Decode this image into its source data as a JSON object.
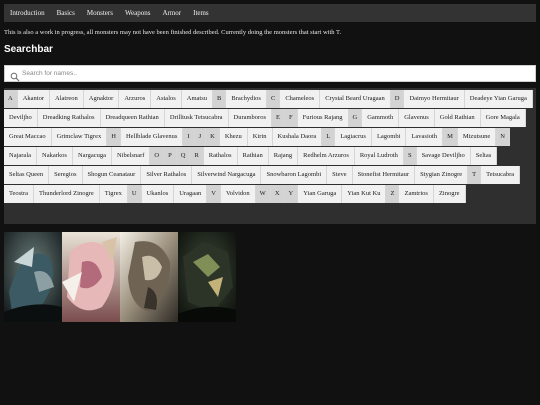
{
  "nav": [
    {
      "label": "Introduction"
    },
    {
      "label": "Basics"
    },
    {
      "label": "Monsters"
    },
    {
      "label": "Weapons"
    },
    {
      "label": "Armor"
    },
    {
      "label": "Items"
    }
  ],
  "notice": "This is also a work in progress, all monsters may not have been finished described. Currently doing the monsters that start with T.",
  "search": {
    "heading": "Searchbar",
    "placeholder": "Search for names.."
  },
  "tags": [
    {
      "t": "A",
      "k": "letter"
    },
    {
      "t": "Akantor"
    },
    {
      "t": "Alatreon"
    },
    {
      "t": "Agnaktor"
    },
    {
      "t": "Arzuros"
    },
    {
      "t": "Astalos"
    },
    {
      "t": "Amatsu"
    },
    {
      "t": "B",
      "k": "letter"
    },
    {
      "t": "Brachydios"
    },
    {
      "t": "C",
      "k": "letter"
    },
    {
      "t": "Chameleos"
    },
    {
      "t": "Crystal Beard Uragaan"
    },
    {
      "t": "D",
      "k": "letter"
    },
    {
      "t": "Daimyo Hermitaur"
    },
    {
      "t": "Deadeye Yian Garuga"
    },
    {
      "t": "Deviljho"
    },
    {
      "t": "Dreadking Rathalos"
    },
    {
      "t": "Dreadqueen Rathian"
    },
    {
      "t": "Drilltusk Tetsucabra"
    },
    {
      "t": "Duramboros"
    },
    {
      "t": "E",
      "k": "letter"
    },
    {
      "t": "F",
      "k": "letter"
    },
    {
      "t": "Furious Rajang"
    },
    {
      "t": "G",
      "k": "letter"
    },
    {
      "t": "Gammoth"
    },
    {
      "t": "Glavenus"
    },
    {
      "t": "Gold Rathian"
    },
    {
      "t": "Gore Magala"
    },
    {
      "t": "Great Maccao"
    },
    {
      "t": "Grimclaw Tigrex"
    },
    {
      "t": "H",
      "k": "letter"
    },
    {
      "t": "Hellblade Glavenus"
    },
    {
      "t": "I",
      "k": "letter"
    },
    {
      "t": "J",
      "k": "letter"
    },
    {
      "t": "K",
      "k": "letter"
    },
    {
      "t": "Khezu"
    },
    {
      "t": "Kirin"
    },
    {
      "t": "Kushala Daora"
    },
    {
      "t": "L",
      "k": "letter"
    },
    {
      "t": "Lagiacrus"
    },
    {
      "t": "Lagombi"
    },
    {
      "t": "Lavasioth"
    },
    {
      "t": "M",
      "k": "letter"
    },
    {
      "t": "Mizutsune"
    },
    {
      "t": "N",
      "k": "letter"
    },
    {
      "t": "Najarala"
    },
    {
      "t": "Nakarkos"
    },
    {
      "t": "Nargacuga"
    },
    {
      "t": "Nibelsnarf"
    },
    {
      "t": "O",
      "k": "letter"
    },
    {
      "t": "P",
      "k": "letter"
    },
    {
      "t": "Q",
      "k": "letter"
    },
    {
      "t": "R",
      "k": "letter"
    },
    {
      "t": "Rathalos"
    },
    {
      "t": "Rathian"
    },
    {
      "t": "Rajang"
    },
    {
      "t": "Redhelm Arzuros"
    },
    {
      "t": "Royal Ludroth"
    },
    {
      "t": "S",
      "k": "letter"
    },
    {
      "t": "Savage Deviljho"
    },
    {
      "t": "Seltas"
    },
    {
      "t": "Seltas Queen"
    },
    {
      "t": "Seregios"
    },
    {
      "t": "Shogun Ceanataur"
    },
    {
      "t": "Silver Rathalos"
    },
    {
      "t": "Silverwind Nargacuga"
    },
    {
      "t": "Snowbaron Lagombi"
    },
    {
      "t": "Steve"
    },
    {
      "t": "Stonefist Hermitaur"
    },
    {
      "t": "Stygian Zinogre"
    },
    {
      "t": "T",
      "k": "letter"
    },
    {
      "t": "Tetsucabra"
    },
    {
      "t": "Teostra"
    },
    {
      "t": "Thunderlord Zinogre"
    },
    {
      "t": "Tigrex"
    },
    {
      "t": "U",
      "k": "letter"
    },
    {
      "t": "Ukanlos"
    },
    {
      "t": "Uragaan"
    },
    {
      "t": "V",
      "k": "letter"
    },
    {
      "t": "Volvidon"
    },
    {
      "t": "W",
      "k": "letter"
    },
    {
      "t": "X",
      "k": "letter"
    },
    {
      "t": "Y",
      "k": "letter"
    },
    {
      "t": "Yian Garuga"
    },
    {
      "t": "Yian Kut Ku"
    },
    {
      "t": "Z",
      "k": "letter"
    },
    {
      "t": "Zamtrios"
    },
    {
      "t": "Zinogre"
    }
  ],
  "images": [
    "monster-image-1",
    "monster-image-2",
    "monster-image-3",
    "monster-image-4"
  ],
  "colors": {
    "nav_bg": "#333333",
    "page_bg": "#111111",
    "tag_bg": "#f1f1f1",
    "letter_bg": "#d3d3d3"
  }
}
